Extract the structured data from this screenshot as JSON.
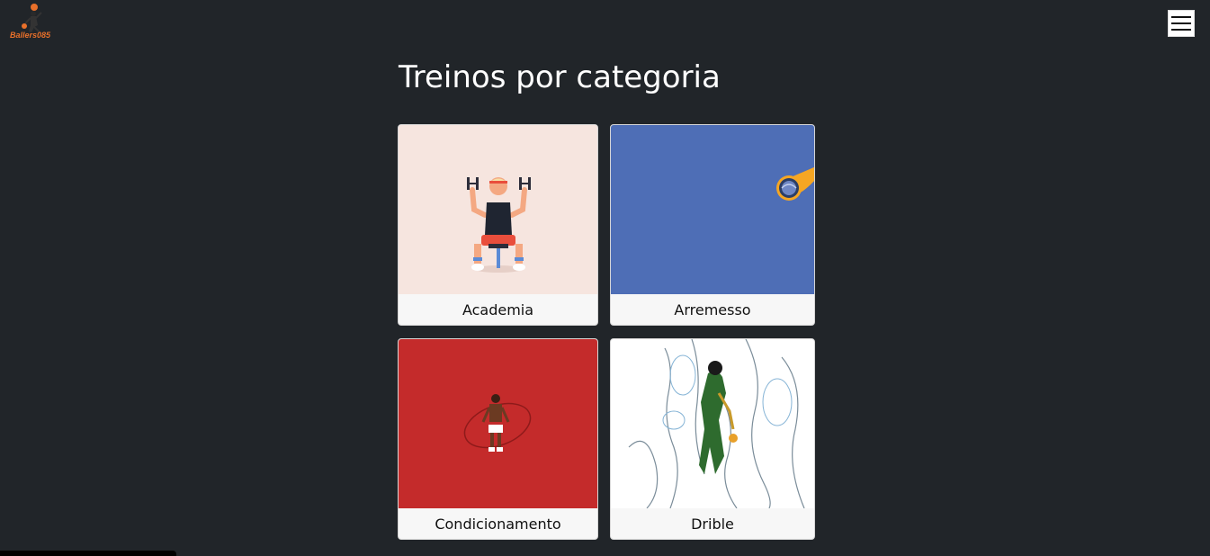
{
  "header": {
    "logo_text": "Ballers085",
    "menu_icon": "hamburger-icon"
  },
  "main": {
    "title": "Treinos por categoria",
    "categories": [
      {
        "label": "Academia",
        "bg": "#f6e5df"
      },
      {
        "label": "Arremesso",
        "bg": "#4e6eb6"
      },
      {
        "label": "Condicionamento",
        "bg": "#c42b2b"
      },
      {
        "label": "Drible",
        "bg": "#ffffff"
      }
    ]
  },
  "colors": {
    "page_bg": "#212529",
    "card_bg": "#f7f7f7",
    "accent": "#e8702a"
  }
}
